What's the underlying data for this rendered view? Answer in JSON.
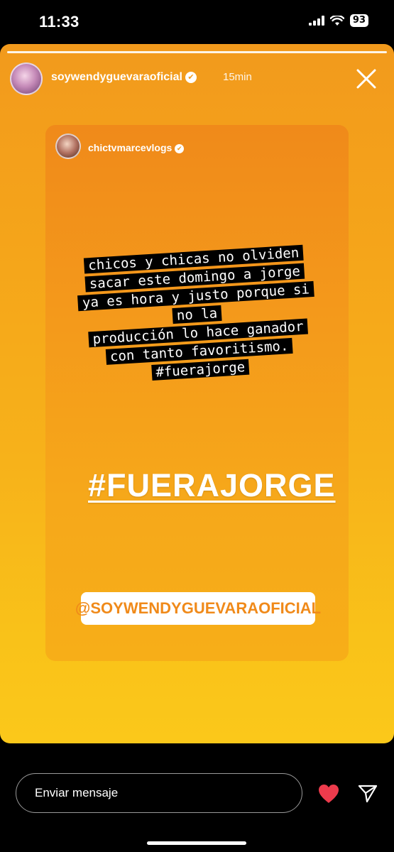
{
  "status_bar": {
    "time": "11:33",
    "battery": "93",
    "signal_icon": "signal-bars-icon",
    "wifi_icon": "wifi-icon"
  },
  "story": {
    "username": "soywendyguevaraoficial",
    "time_ago": "15min",
    "verified_icon": "verified-badge-icon",
    "close_icon": "close-icon",
    "background_colors": [
      "#f29a1c",
      "#fbc81a"
    ]
  },
  "reshared_post": {
    "username": "chictvmarcevlogs",
    "caption_lines": [
      "chicos y chicas no olviden",
      "sacar este domingo a jorge",
      "ya es hora y justo porque si",
      "no la",
      "producción lo hace ganador",
      "con tanto favoritismo.",
      "#fuerajorge"
    ],
    "hashtag_sticker": "#FUERAJORGE",
    "mention_sticker": "@SOYWENDYGUEVARAOFICIAL"
  },
  "bottom_bar": {
    "message_placeholder": "Enviar mensaje",
    "like_icon": "heart-icon",
    "send_icon": "send-icon",
    "like_color": "#ed3b4c"
  }
}
